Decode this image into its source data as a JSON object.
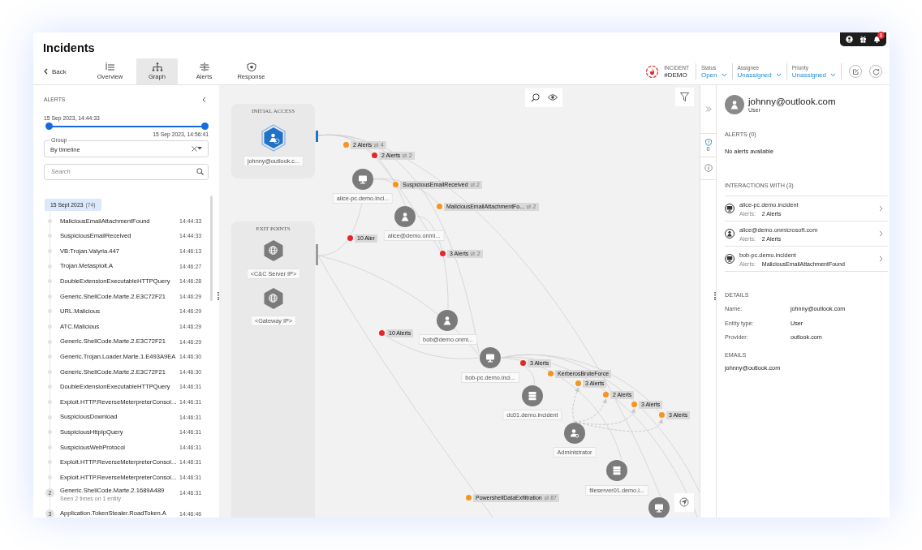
{
  "title": "Incidents",
  "back": {
    "label": "Back"
  },
  "tabs": [
    {
      "label": "Overview",
      "selected": false
    },
    {
      "label": "Graph",
      "selected": true
    },
    {
      "label": "Alerts",
      "selected": false
    },
    {
      "label": "Response",
      "selected": false
    }
  ],
  "incident": {
    "label": "INCIDENT",
    "id": "#DEMO"
  },
  "fields": [
    {
      "label": "Status",
      "value": "Open"
    },
    {
      "label": "Assignee",
      "value": "Unassigned"
    },
    {
      "label": "Priority",
      "value": "Unassigned"
    }
  ],
  "notifications": {
    "count": "8"
  },
  "alerts_panel": {
    "title": "ALERTS",
    "range_start": "15 Sep 2023, 14:44:33",
    "range_end": "15 Sep 2023, 14:56:41",
    "range": {
      "level": 1
    },
    "group": {
      "label": "Group",
      "value": "By timeline"
    },
    "search": {
      "placeholder": "Search"
    },
    "date_group": {
      "date": "15 Sept 2023",
      "count": "(74)"
    },
    "items": [
      {
        "name": "MaliciousEmailAttachmentFound",
        "time": "14:44:33"
      },
      {
        "name": "SuspiciousEmailReceived",
        "time": "14:44:33"
      },
      {
        "name": "VB:Trojan.Valyria.447",
        "time": "14:46:13"
      },
      {
        "name": "Trojan.Metasploit.A",
        "time": "14:46:27"
      },
      {
        "name": "DoubleExtensionExecutableHTTPQuery",
        "time": "14:46:28"
      },
      {
        "name": "Generic.ShellCode.Marte.2.E3C72F21",
        "time": "14:46:29"
      },
      {
        "name": "URL.Malicious",
        "time": "14:46:29"
      },
      {
        "name": "ATC.Malicious",
        "time": "14:46:29"
      },
      {
        "name": "Generic.ShellCode.Marte.2.E3C72F21",
        "time": "14:46:29"
      },
      {
        "name": "Generic.Trojan.Loader.Marte.1.E493A9EA",
        "time": "14:46:30"
      },
      {
        "name": "Generic.ShellCode.Marte.2.E3C72F21",
        "time": "14:46:30"
      },
      {
        "name": "DoubleExtensionExecutableHTTPQuery",
        "time": "14:46:31"
      },
      {
        "name": "Exploit.HTTP.ReverseMeterpreterConsol...",
        "time": "14:46:31"
      },
      {
        "name": "SuspiciousDownload",
        "time": "14:46:31"
      },
      {
        "name": "SuspiciousHttpIpQuery",
        "time": "14:46:31"
      },
      {
        "name": "SuspiciousWebProtocol",
        "time": "14:46:31"
      },
      {
        "name": "Exploit.HTTP.ReverseMeterpreterConsol...",
        "time": "14:46:31"
      },
      {
        "name": "Exploit.HTTP.ReverseMeterpreterConsol...",
        "time": "14:46:31"
      },
      {
        "name": "Generic.ShellCode.Marte.2.1689A489",
        "time": "14:46:31",
        "count": "2",
        "note": "Seen 2 times on 1 entity"
      },
      {
        "name": "Application.TokenStealer.RoadToken.A",
        "time": "14:46:46",
        "count": "3"
      }
    ]
  },
  "graph": {
    "groups": [
      {
        "title": "INITIAL ACCESS",
        "nodes": [
          {
            "label": "johnny@outlook.c...",
            "kind": "user",
            "selected": true
          }
        ]
      },
      {
        "title": "EXIT POINTS",
        "nodes": [
          {
            "label": "<C&C Server IP>",
            "kind": "globe",
            "selected": false
          },
          {
            "label": "<Gateway IP>",
            "kind": "globe",
            "selected": false
          }
        ]
      }
    ],
    "nodes": [
      {
        "label": "alice-pc.demo.inci...",
        "kind": "computer"
      },
      {
        "label": "alice@demo.onmi...",
        "kind": "user"
      },
      {
        "label": "bob@demo.onmi...",
        "kind": "user"
      },
      {
        "label": "bob-pc.demo.inci...",
        "kind": "computer"
      },
      {
        "label": "dc01.demo.incident",
        "kind": "server"
      },
      {
        "label": "Administrator",
        "kind": "admin"
      },
      {
        "label": "fileserver01.demo.i...",
        "kind": "server"
      },
      {
        "kind": "computer"
      }
    ],
    "edge_labels": [
      {
        "text": "2 Alerts",
        "count": "4",
        "color": "#f7931e"
      },
      {
        "text": "2 Alerts",
        "count": "2",
        "color": "#e8262a"
      },
      {
        "text": "SuspiciousEmailReceived",
        "count": "2",
        "color": "#f7931e"
      },
      {
        "text": "MaliciousEmailAttachmentFo...",
        "count": "2",
        "color": "#f7931e"
      },
      {
        "text": "10 Aler",
        "color": "#e8262a"
      },
      {
        "text": "3 Alerts",
        "count": "2",
        "color": "#e8262a"
      },
      {
        "text": "10 Alerts",
        "color": "#e8262a"
      },
      {
        "text": "3 Alerts",
        "color": "#e8262a"
      },
      {
        "text": "KerberosBruteForce",
        "color": "#f7931e"
      },
      {
        "text": "3 Alerts",
        "color": "#f7931e"
      },
      {
        "text": "2 Alerts",
        "color": "#f7931e"
      },
      {
        "text": "3 Alerts",
        "color": "#f7931e"
      },
      {
        "text": "3 Alerts",
        "color": "#f7931e"
      },
      {
        "text": "PowershellDataExfiltration",
        "count": "87",
        "color": "#f7931e"
      }
    ]
  },
  "strip": {
    "alert_count": "0"
  },
  "entity": {
    "name": "johnny@outlook.com",
    "type": "User"
  },
  "alerts_section": {
    "heading": "ALERTS (0)",
    "empty": "No alerts available"
  },
  "interactions_section": {
    "heading": "INTERACTIONS WITH (3)",
    "items": [
      {
        "name": "alice-pc.demo.incident",
        "kind": "computer",
        "alerts_label": "Alerts:",
        "alerts": "2 Alerts"
      },
      {
        "name": "alice@demo.onmicrosoft.com",
        "kind": "user",
        "alerts_label": "Alerts:",
        "alerts": "2 Alerts"
      },
      {
        "name": "bob-pc.demo.incident",
        "kind": "computer",
        "alerts_label": "Alerts:",
        "alerts": "MaliciousEmailAttachmentFound"
      }
    ]
  },
  "details_section": {
    "heading": "DETAILS",
    "rows": [
      {
        "label": "Name:",
        "value": "johnny@outlook.com"
      },
      {
        "label": "Entity type:",
        "value": "User"
      },
      {
        "label": "Provider:",
        "value": "outlook.com"
      }
    ]
  },
  "emails_section": {
    "heading": "EMAILS",
    "items": [
      "johnny@outlook.com"
    ]
  }
}
